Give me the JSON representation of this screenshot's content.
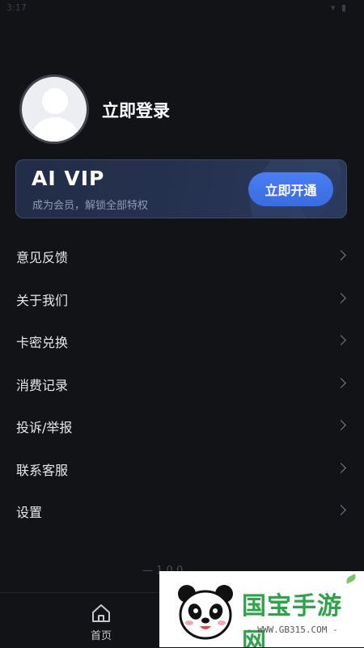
{
  "status_bar": {
    "time": "3:17",
    "icons": "▾ ▮"
  },
  "profile": {
    "login_label": "立即登录"
  },
  "vip": {
    "title": "AI VIP",
    "subtitle": "成为会员，解锁全部特权",
    "button_label": "立即开通"
  },
  "menu": {
    "items": [
      {
        "label": "意见反馈"
      },
      {
        "label": "关于我们"
      },
      {
        "label": "卡密兑换"
      },
      {
        "label": "消费记录"
      },
      {
        "label": "投诉/举报"
      },
      {
        "label": "联系客服"
      },
      {
        "label": "设置"
      }
    ]
  },
  "version": "— 1.0.0",
  "tabbar": {
    "home_label": "首页"
  },
  "watermark": {
    "title": "国宝手游网",
    "url": "- WWW.GB315.COM -"
  },
  "colors": {
    "background": "#121317",
    "accent": "#3f74ea",
    "vip_card": "#253250"
  }
}
